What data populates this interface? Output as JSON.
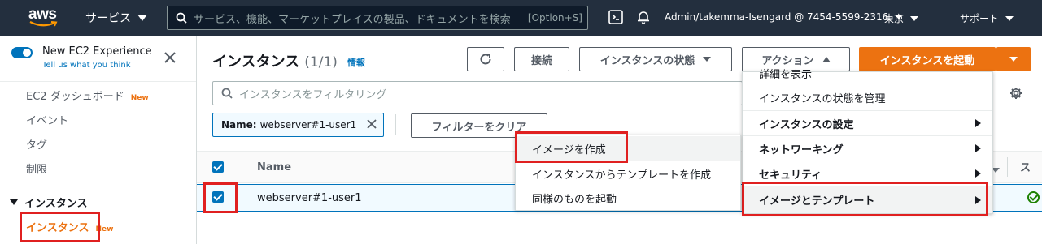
{
  "topnav": {
    "logo": "aws",
    "services_label": "サービス",
    "search_placeholder": "サービス、機能、マーケットプレイスの製品、ドキュメントを検索",
    "search_shortcut": "[Option+S]",
    "account_label": "Admin/takemma-Isengard @ 7454-5599-2316",
    "region_label": "東京",
    "support_label": "サポート",
    "icons": [
      "cloudshell-icon",
      "bell-icon"
    ]
  },
  "sidebar": {
    "experience_title": "New EC2 Experience",
    "experience_link": "Tell us what you think",
    "items": [
      {
        "label": "EC2 ダッシュボード",
        "badge": "New"
      },
      {
        "label": "イベント"
      },
      {
        "label": "タグ"
      },
      {
        "label": "制限"
      }
    ],
    "section_label": "インスタンス",
    "active_item": {
      "label": "インスタンス",
      "badge": "New"
    }
  },
  "main": {
    "title": "インスタンス",
    "count": "(1/1)",
    "info_link": "情報",
    "buttons": {
      "connect": "接続",
      "instance_state": "インスタンスの状態",
      "actions": "アクション",
      "launch": "インスタンスを起動"
    },
    "filter_placeholder": "インスタンスをフィルタリング",
    "filter_token": {
      "key": "Name:",
      "value": "webserver#1-user1"
    },
    "clear_filters": "フィルターをクリア",
    "table": {
      "columns": [
        "Name",
        "ス"
      ],
      "rows": [
        {
          "name": "webserver#1-user1",
          "checked": true
        }
      ]
    }
  },
  "actions_menu": {
    "items": [
      {
        "label": "詳細を表示",
        "bold": false,
        "submenu": false
      },
      {
        "label": "インスタンスの状態を管理",
        "bold": false,
        "submenu": false
      },
      {
        "label": "インスタンスの設定",
        "bold": true,
        "submenu": true
      },
      {
        "label": "ネットワーキング",
        "bold": true,
        "submenu": true
      },
      {
        "label": "セキュリティ",
        "bold": true,
        "submenu": true
      },
      {
        "label": "イメージとテンプレート",
        "bold": true,
        "submenu": true
      }
    ]
  },
  "image_submenu": {
    "items": [
      {
        "label": "イメージを作成"
      },
      {
        "label": "インスタンスからテンプレートを作成"
      },
      {
        "label": "同様のものを起動"
      }
    ]
  },
  "colors": {
    "nav_bg": "#232f3e",
    "primary": "#ec7211",
    "link": "#0073bb",
    "highlight": "#e02020",
    "status_ok": "#1d8102"
  }
}
